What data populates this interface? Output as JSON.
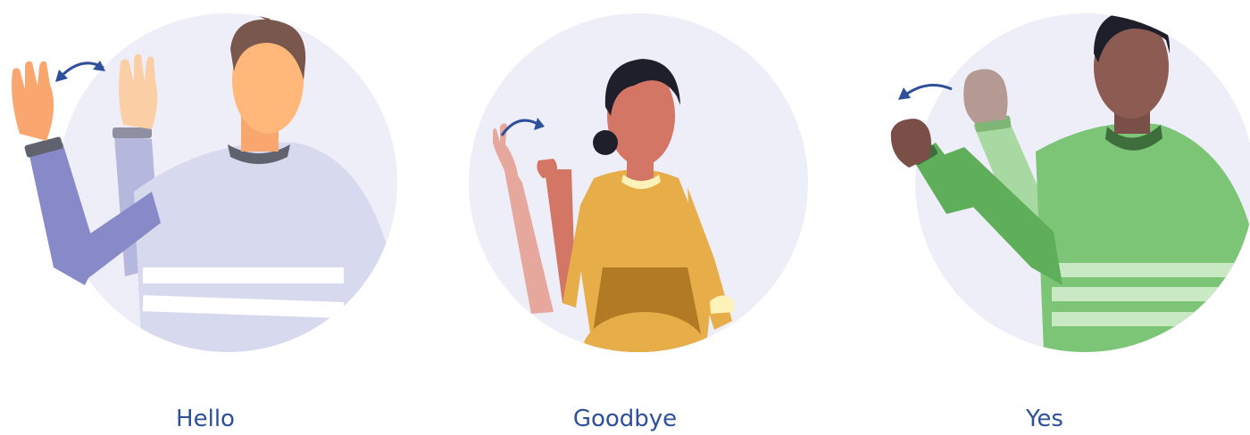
{
  "signs": [
    {
      "label": "Hello",
      "figure": "man-waving-hand-icon",
      "arrow": "curved-double-arrow-icon"
    },
    {
      "label": "Goodbye",
      "figure": "woman-waving-goodbye-icon",
      "arrow": "curved-arrow-right-icon"
    },
    {
      "label": "Yes",
      "figure": "man-nodding-fist-icon",
      "arrow": "curved-arrow-left-icon"
    }
  ],
  "colors": {
    "circle_bg": "#eeeef8",
    "caption_text": "#2e4f9a",
    "arrow": "#2e4f9a",
    "hello_sweater": "#d7d9ee",
    "goodbye_sweater": "#e6ad48",
    "yes_sweater": "#7cc576"
  }
}
